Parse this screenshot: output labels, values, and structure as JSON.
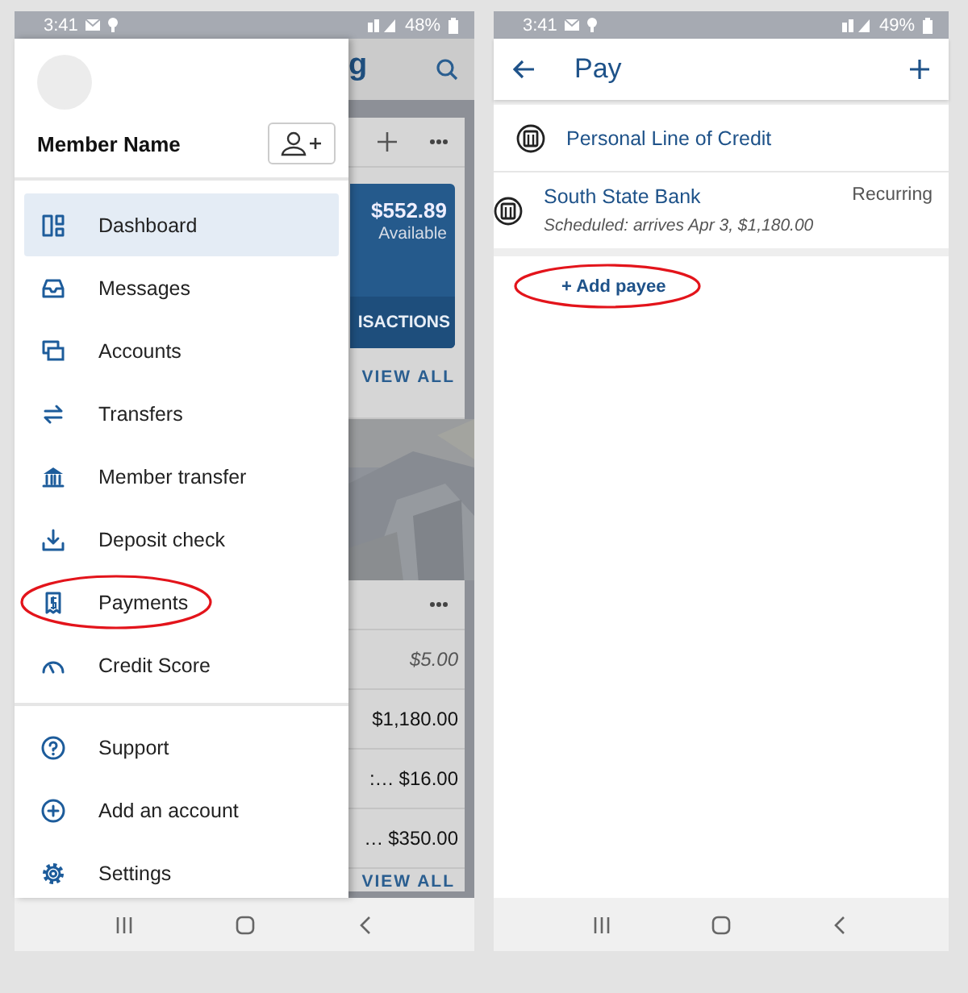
{
  "left_phone": {
    "status_bar": {
      "time": "3:41",
      "battery": "48%"
    },
    "drawer": {
      "member_name": "Member Name",
      "sections": [
        {
          "items": [
            {
              "label": "Dashboard",
              "kind": "dashboard",
              "selected": true,
              "circled": false
            },
            {
              "label": "Messages",
              "kind": "messages",
              "selected": false,
              "circled": false
            },
            {
              "label": "Accounts",
              "kind": "accounts",
              "selected": false,
              "circled": false
            },
            {
              "label": "Transfers",
              "kind": "transfers",
              "selected": false,
              "circled": false
            },
            {
              "label": "Member transfer",
              "kind": "bank",
              "selected": false,
              "circled": false
            },
            {
              "label": "Deposit check",
              "kind": "deposit",
              "selected": false,
              "circled": false
            },
            {
              "label": "Payments",
              "kind": "payments",
              "selected": false,
              "circled": true
            },
            {
              "label": "Credit Score",
              "kind": "gauge",
              "selected": false,
              "circled": false
            }
          ]
        },
        {
          "items": [
            {
              "label": "Support",
              "kind": "help",
              "selected": false,
              "circled": false
            },
            {
              "label": "Add an account",
              "kind": "add",
              "selected": false,
              "circled": false
            },
            {
              "label": "Settings",
              "kind": "settings",
              "selected": false,
              "circled": false
            }
          ]
        }
      ]
    },
    "background_screen": {
      "title_fragment": "g",
      "account_card": {
        "balance": "$552.89",
        "balance_label": "Available",
        "footer": "ISACTIONS",
        "link": "VIEW ALL"
      },
      "activity_card": {
        "rows": [
          {
            "amount": "$5.00",
            "pending": true
          },
          {
            "amount": "$1,180.00",
            "pending": false
          },
          {
            "fragment": ":…",
            "amount": "$16.00",
            "pending": false
          },
          {
            "fragment": "…",
            "amount": "$350.00",
            "pending": false
          }
        ],
        "link": "VIEW ALL"
      }
    }
  },
  "right_phone": {
    "status_bar": {
      "time": "3:41",
      "battery": "49%"
    },
    "title": "Pay",
    "payees": [
      {
        "name": "Personal Line of Credit"
      },
      {
        "name": "South State Bank",
        "status": "Recurring",
        "detail": "Scheduled: arrives Apr 3, $1,180.00"
      }
    ],
    "add_payee": {
      "label": "+ Add payee",
      "circled": true
    }
  }
}
